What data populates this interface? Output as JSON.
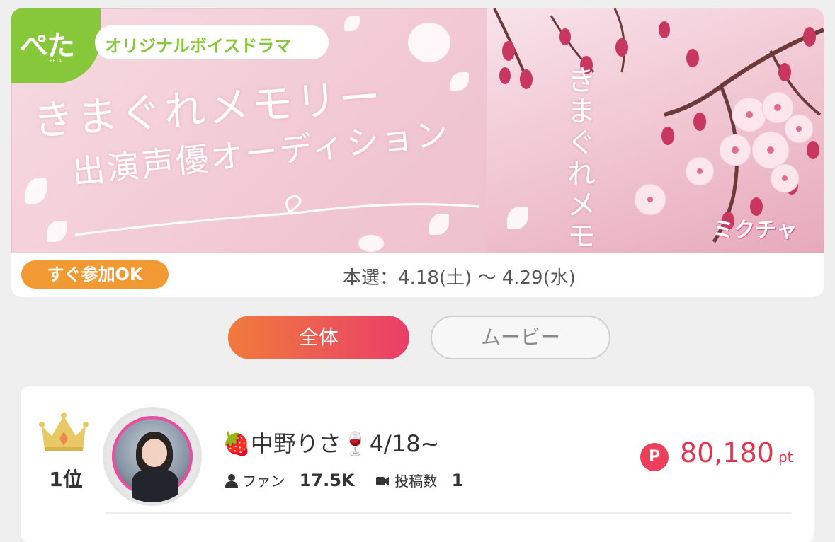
{
  "banner": {
    "logo": "ぺた",
    "logo_sub": "PETA",
    "series_label": "オリジナルボイスドラマ",
    "title_line1": "きまぐれメモリー",
    "title_line2": "出演声優オーディション",
    "vertical_title": "きまぐれメモリ",
    "brand_logo": "ミクチャ",
    "quick_join_badge": "すぐ参加OK",
    "schedule": "本選：4.18(土) 〜 4.29(水)"
  },
  "tabs": [
    {
      "label": "全体",
      "active": true
    },
    {
      "label": "ムービー",
      "active": false
    }
  ],
  "ranking": [
    {
      "rank": "1位",
      "name": "🍓中野りさ🍷4/18~",
      "fans_label": "ファン",
      "fans_value": "17.5K",
      "posts_label": "投稿数",
      "posts_value": "1",
      "points_badge": "P",
      "points": "80,180",
      "points_unit": "pt"
    }
  ],
  "colors": {
    "accent_gradient_start": "#f07b3c",
    "accent_gradient_end": "#ea3d6a",
    "points_red": "#e2364f",
    "brand_green": "#86c83a",
    "badge_orange": "#f19a34"
  },
  "icons": [
    "crown-icon",
    "person-icon",
    "video-icon",
    "points-icon",
    "avatar-image"
  ]
}
